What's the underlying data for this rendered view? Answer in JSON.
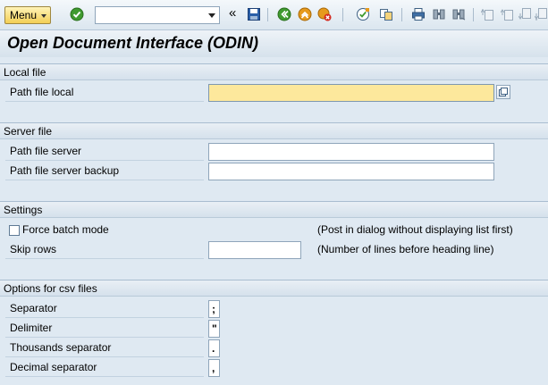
{
  "toolbar": {
    "menu_label": "Menu",
    "command_field_value": "",
    "back_symbol": "«"
  },
  "page": {
    "title": "Open Document Interface (ODIN)"
  },
  "sections": {
    "local_file": {
      "header": "Local file",
      "path_label": "Path file local",
      "path_value": ""
    },
    "server_file": {
      "header": "Server file",
      "path_label": "Path file server",
      "path_value": "",
      "backup_label": "Path file server backup",
      "backup_value": ""
    },
    "settings": {
      "header": "Settings",
      "force_batch_label": "Force batch mode",
      "force_batch_checked": false,
      "force_batch_hint": "(Post in dialog without displaying list first)",
      "skip_rows_label": "Skip rows",
      "skip_rows_value": "",
      "skip_rows_hint": "(Number of lines before heading line)"
    },
    "csv": {
      "header": "Options for csv files",
      "separator_label": "Separator",
      "separator_value": ";",
      "delimiter_label": "Delimiter",
      "delimiter_value": "\"",
      "thousands_label": "Thousands separator",
      "thousands_value": ".",
      "decimal_label": "Decimal separator",
      "decimal_value": ","
    }
  },
  "colors": {
    "background": "#dfe9f2",
    "required_field": "#fde89c",
    "menu_button": "#f3cf55"
  },
  "icons": [
    "checkmark-icon",
    "save-icon",
    "back-icon",
    "exit-icon",
    "cancel-icon",
    "help-icon",
    "layout-icon",
    "print-icon",
    "find-icon",
    "find-next-icon",
    "first-page-icon",
    "previous-page-icon",
    "next-page-icon",
    "last-page-icon",
    "value-help-icon"
  ]
}
